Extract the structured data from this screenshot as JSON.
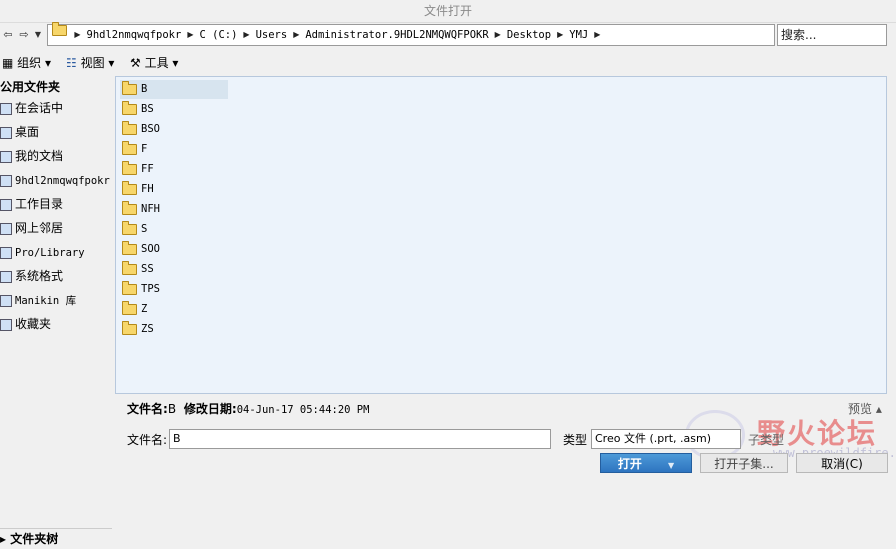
{
  "window": {
    "title": "文件打开"
  },
  "address": {
    "crumbs": [
      "9hdl2nmqwqfpokr",
      "C (C:)",
      "Users",
      "Administrator.9HDL2NMQWQFPOKR",
      "Desktop",
      "YMJ"
    ],
    "search_placeholder": "搜索..."
  },
  "toolbar": {
    "organize": "组织",
    "view": "视图",
    "tools": "工具",
    "help_icon": "help-cursor-icon"
  },
  "sidebar": {
    "header": "公用文件夹",
    "items": [
      {
        "label": "在会话中",
        "icon": "session-icon"
      },
      {
        "label": "桌面",
        "icon": "desktop-icon"
      },
      {
        "label": "我的文档",
        "icon": "documents-icon"
      },
      {
        "label": "9hdl2nmqwqfpokr",
        "icon": "computer-icon"
      },
      {
        "label": "工作目录",
        "icon": "workdir-icon"
      },
      {
        "label": "网上邻居",
        "icon": "network-icon"
      },
      {
        "label": "Pro/Library",
        "icon": "library-icon"
      },
      {
        "label": "系统格式",
        "icon": "system-format-icon"
      },
      {
        "label": "Manikin 库",
        "icon": "manikin-icon"
      },
      {
        "label": "收藏夹",
        "icon": "favorites-icon"
      }
    ],
    "footer": "文件夹树"
  },
  "files": [
    "B",
    "BS",
    "BSO",
    "F",
    "FF",
    "FH",
    "NFH",
    "S",
    "SOO",
    "SS",
    "TPS",
    "Z",
    "ZS"
  ],
  "selected_file": "B",
  "info": {
    "name_label": "文件名:",
    "name_value": "B",
    "date_label": "修改日期:",
    "date_value": "04-Jun-17 05:44:20 PM",
    "preview_label": "预览"
  },
  "bottom": {
    "filename_label": "文件名:",
    "filename_value": "B",
    "type_label": "类型",
    "type_value": "Creo 文件 (.prt, .asm)",
    "subtype_label": "子类型",
    "open_button": "打开",
    "open_sub_button": "打开子集...",
    "cancel_button": "取消(C)"
  },
  "watermark": {
    "title": "野火论坛",
    "sub": "www.proewildfire.cn"
  }
}
